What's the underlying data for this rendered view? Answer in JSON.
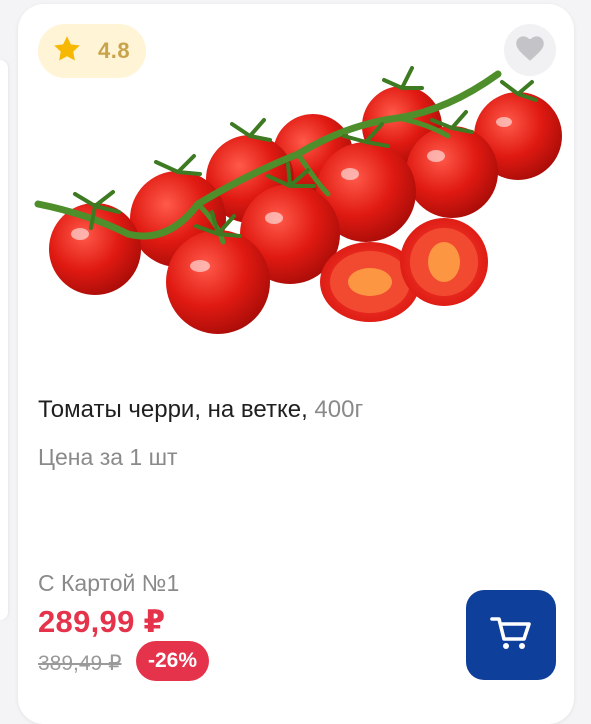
{
  "rating": {
    "value": "4.8",
    "icon": "star-icon",
    "star_color": "#f6b800"
  },
  "favorite": {
    "icon": "heart-icon"
  },
  "product": {
    "name": "Томаты черри, на ветке,",
    "weight": "400г",
    "image": "cherry-tomatoes-on-vine",
    "unit_price_label": "Цена за 1 шт"
  },
  "pricing": {
    "card_label": "С Картой №1",
    "price": "289,99 ₽",
    "old_price": "389,49 ₽",
    "discount": "-26%",
    "price_color": "#e4334a"
  },
  "cart": {
    "icon": "cart-icon",
    "button_color": "#0e3f9a"
  }
}
